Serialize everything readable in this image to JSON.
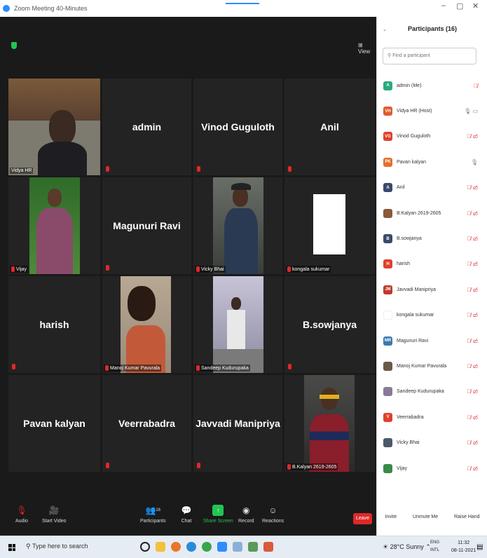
{
  "window": {
    "title": "Zoom Meeting 40-Minutes",
    "view_label": "View"
  },
  "tiles": [
    {
      "name": "Vidya HR",
      "type": "video",
      "label": "Vidya HR"
    },
    {
      "name": "admin",
      "type": "name"
    },
    {
      "name": "Vinod Guguloth",
      "type": "name"
    },
    {
      "name": "Anil",
      "type": "name"
    },
    {
      "name": "Vijay",
      "type": "video",
      "label": "Vijay"
    },
    {
      "name": "Magunuri Ravi",
      "type": "name"
    },
    {
      "name": "Vicky Bhai",
      "type": "video",
      "label": "Vicky Bhai"
    },
    {
      "name": "kongala sukumar",
      "type": "video",
      "label": "kongala sukumar"
    },
    {
      "name": "harish",
      "type": "name"
    },
    {
      "name": "Manoj Kumar Pavurala",
      "type": "video",
      "label": "Manoj Kumar Pavurala"
    },
    {
      "name": "Sandeep Kudurupaka",
      "type": "video",
      "label": "Sandeep Kudurupaka"
    },
    {
      "name": "B.sowjanya",
      "type": "name"
    },
    {
      "name": "Pavan kalyan",
      "type": "name"
    },
    {
      "name": "Veerrabadra",
      "type": "name"
    },
    {
      "name": "Javvadi Manipriya",
      "type": "name"
    },
    {
      "name": "B.Kalyan 2619-2605",
      "type": "video",
      "label": "B.Kalyan 2619-2605"
    }
  ],
  "controls": {
    "audio": "Audio",
    "start_video": "Start Video",
    "participants": "Participants",
    "participants_count": "16",
    "chat": "Chat",
    "share_screen": "Share Screen",
    "record": "Record",
    "reactions": "Reactions",
    "leave": "Leave"
  },
  "panel": {
    "title": "Participants (16)",
    "search_placeholder": "Find a participant",
    "participants": [
      {
        "initials": "A",
        "name": "admin (Me)",
        "color": "#2ca87f",
        "status": "mic-off"
      },
      {
        "initials": "VH",
        "name": "Vidya HR (Host)",
        "color": "#e05a2b",
        "status": "mic-on cam"
      },
      {
        "initials": "VG",
        "name": "Vinod Guguloth",
        "color": "#e0402b",
        "status": "mic-off cam-off"
      },
      {
        "initials": "PK",
        "name": "Pavan kalyan",
        "color": "#e0702b",
        "status": "mic-on"
      },
      {
        "initials": "A",
        "name": "Anil",
        "color": "#3a4a6a",
        "status": "mic-off cam-off"
      },
      {
        "initials": "",
        "name": "B.Kalyan 2619-2605",
        "color": "#8a5a3a",
        "status": "mic-off cam-off"
      },
      {
        "initials": "B",
        "name": "B.sowjanya",
        "color": "#3a4a6a",
        "status": "mic-off cam-off"
      },
      {
        "initials": "H",
        "name": "harish",
        "color": "#e0402b",
        "status": "mic-off cam-off"
      },
      {
        "initials": "JM",
        "name": "Javvadi Manipriya",
        "color": "#c0392b",
        "status": "mic-off cam-off"
      },
      {
        "initials": "",
        "name": "kongala sukumar",
        "color": "#ffffff",
        "status": "mic-off cam-off"
      },
      {
        "initials": "MR",
        "name": "Magunuri Ravi",
        "color": "#3a7ab0",
        "status": "mic-off cam-off"
      },
      {
        "initials": "",
        "name": "Manoj Kumar Pavurala",
        "color": "#6a5a4a",
        "status": "mic-off cam-off"
      },
      {
        "initials": "",
        "name": "Sandeep Kudurupaka",
        "color": "#8a7a9a",
        "status": "mic-off cam-off"
      },
      {
        "initials": "V",
        "name": "Veerrabadra",
        "color": "#e0402b",
        "status": "mic-off cam-off"
      },
      {
        "initials": "",
        "name": "Vicky Bhai",
        "color": "#4a5a6a",
        "status": "mic-off cam-off"
      },
      {
        "initials": "",
        "name": "Vijay",
        "color": "#3a8a4a",
        "status": "mic-off cam-off"
      }
    ],
    "invite": "Invite",
    "unmute_me": "Unmute Me",
    "raise_hand": "Raise Hand"
  },
  "taskbar": {
    "search": "Type here to search",
    "weather": "28°C  Sunny",
    "lang_top": "ENG",
    "lang_bottom": "INTL",
    "time": "11:32",
    "date": "08-11-2021"
  }
}
